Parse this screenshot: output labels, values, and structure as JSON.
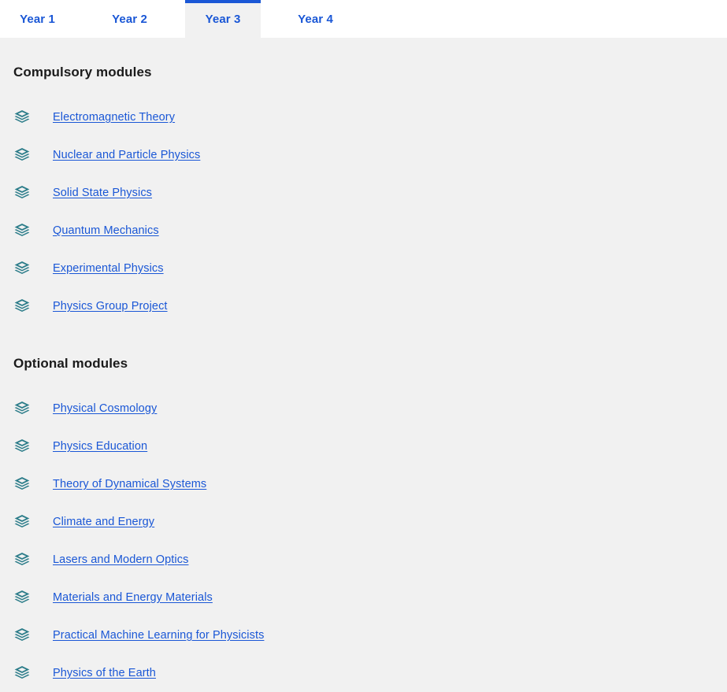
{
  "tabs": {
    "items": [
      {
        "label": "Year 1",
        "active": false
      },
      {
        "label": "Year 2",
        "active": false
      },
      {
        "label": "Year 3",
        "active": true
      },
      {
        "label": "Year 4",
        "active": false
      }
    ]
  },
  "colors": {
    "link_blue": "#1a57d6",
    "icon_teal": "#2d7d8a",
    "page_bg": "#f1f1f1",
    "tabbar_bg": "#ffffff",
    "heading": "#1b1b1b"
  },
  "sections": [
    {
      "title": "Compulsory modules",
      "icon": "layers-icon",
      "modules": [
        "Electromagnetic Theory",
        "Nuclear and Particle Physics",
        "Solid State Physics",
        "Quantum Mechanics",
        "Experimental Physics",
        "Physics Group Project"
      ]
    },
    {
      "title": "Optional modules",
      "icon": "layers-icon",
      "modules": [
        "Physical Cosmology",
        "Physics Education",
        "Theory of Dynamical Systems",
        "Climate and Energy",
        "Lasers and Modern Optics",
        "Materials and Energy Materials",
        "Practical Machine Learning for Physicists",
        "Physics of the Earth"
      ]
    }
  ]
}
